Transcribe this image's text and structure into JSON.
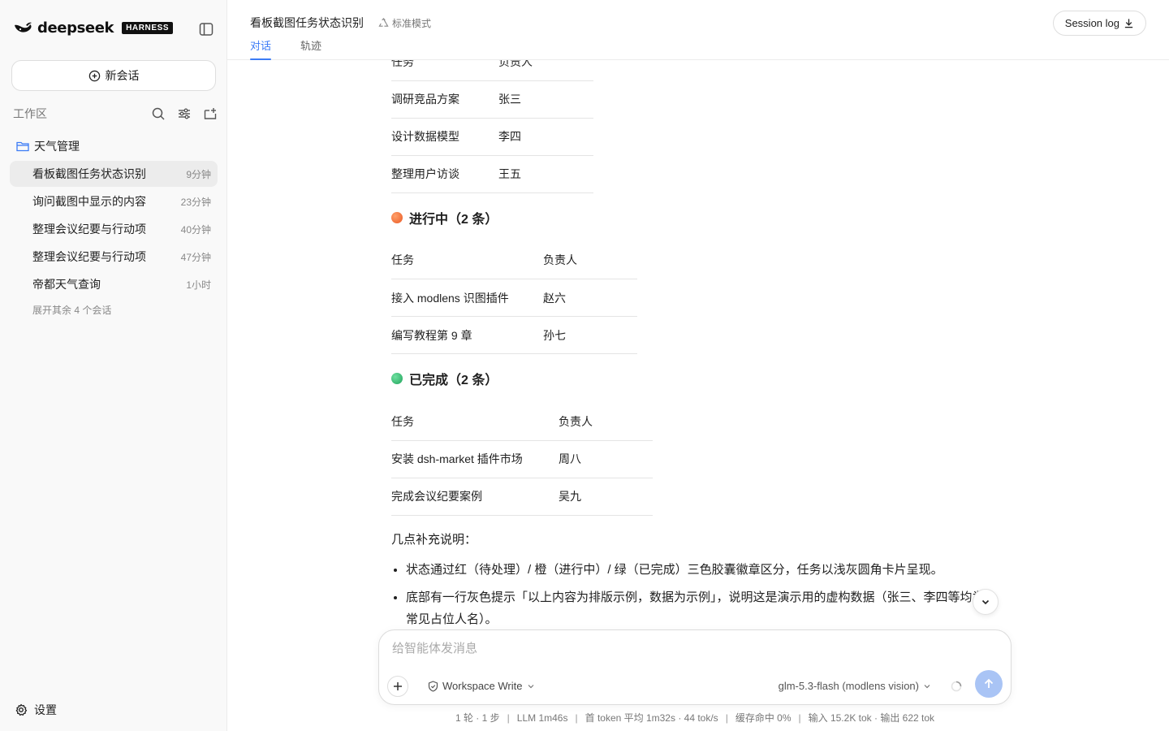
{
  "brand": {
    "name": "deepseek",
    "badge": "HARNESS"
  },
  "sidebar": {
    "new_chat_label": "新会话",
    "workspace_label": "工作区",
    "folder_label": "天气管理",
    "sessions": [
      {
        "title": "看板截图任务状态识别",
        "time": "9分钟",
        "active": true
      },
      {
        "title": "询问截图中显示的内容",
        "time": "23分钟"
      },
      {
        "title": "整理会议纪要与行动项",
        "time": "40分钟"
      },
      {
        "title": "整理会议纪要与行动项",
        "time": "47分钟"
      },
      {
        "title": "帝都天气查询",
        "time": "1小时"
      }
    ],
    "expand_more": "展开其余 4 个会话",
    "settings_label": "设置"
  },
  "header": {
    "title": "看板截图任务状态识别",
    "mode": "标准模式",
    "tabs": [
      "对话",
      "轨迹"
    ],
    "session_log": "Session log"
  },
  "content": {
    "table1": {
      "header": [
        "任务",
        "负责人"
      ],
      "rows": [
        [
          "调研竞品方案",
          "张三"
        ],
        [
          "设计数据模型",
          "李四"
        ],
        [
          "整理用户访谈",
          "王五"
        ]
      ]
    },
    "in_progress": {
      "heading": "进行中（2 条）",
      "color": "#f26b3a",
      "header": [
        "任务",
        "负责人"
      ],
      "rows": [
        [
          "接入 modlens 识图插件",
          "赵六"
        ],
        [
          "编写教程第 9 章",
          "孙七"
        ]
      ]
    },
    "done": {
      "heading": "已完成（2 条）",
      "color": "#2fb36a",
      "header": [
        "任务",
        "负责人"
      ],
      "rows": [
        [
          "安装 dsh-market 插件市场",
          "周八"
        ],
        [
          "完成会议纪要案例",
          "吴九"
        ]
      ]
    },
    "note_title": "几点补充说明：",
    "bullets": [
      "状态通过红（待处理）/ 橙（进行中）/ 绿（已完成）三色胶囊徽章区分，任务以浅灰圆角卡片呈现。",
      "底部有一行灰色提示「以上内容为排版示例，数据为示例」，说明这是演示用的虚构数据（张三、李四等均为常见占位人名）。"
    ]
  },
  "composer": {
    "placeholder": "给智能体发消息",
    "permission": "Workspace Write",
    "model": "glm-5.3-flash (modlens vision)"
  },
  "status": {
    "turns": "1 轮 · 1 步",
    "llm": "LLM 1m46s",
    "first_token": "首 token 平均 1m32s · 44 tok/s",
    "cache": "缓存命中 0%",
    "io": "输入 15.2K tok · 输出 622 tok"
  },
  "colors": {
    "accent": "#3b7bf6",
    "send_button": "#a9c4f5"
  }
}
